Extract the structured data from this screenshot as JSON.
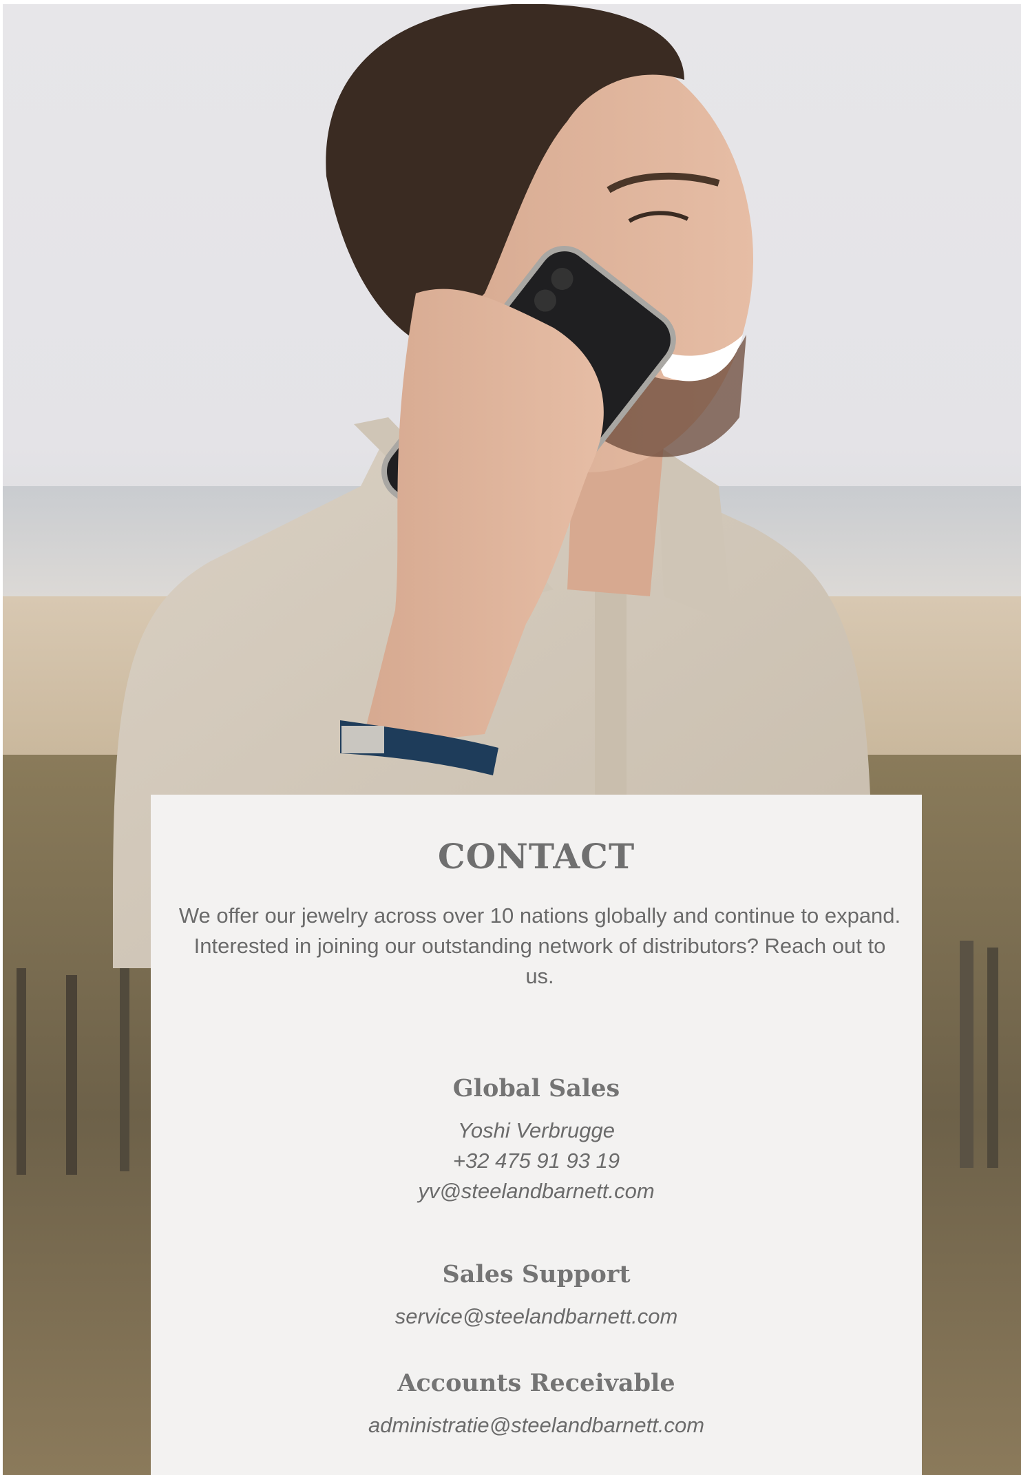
{
  "contact": {
    "title": "CONTACT",
    "intro": "We offer our jewelry across over 10 nations globally and continue to expand. Interested in joining our outstanding network of distributors? Reach out to us.",
    "global_sales": {
      "heading": "Global Sales",
      "name": "Yoshi Verbrugge",
      "phone": "+32 475 91 93 19",
      "email": "yv@steelandbarnett.com"
    },
    "sales_support": {
      "heading": "Sales Support",
      "email": "service@steelandbarnett.com"
    },
    "accounts_receivable": {
      "heading": "Accounts Receivable",
      "email": "administratie@steelandbarnett.com"
    }
  },
  "colors": {
    "card_background": "#f3f2f1",
    "text": "#6d6d6d"
  },
  "icons": {
    "hero": "photo-man-on-phone"
  }
}
